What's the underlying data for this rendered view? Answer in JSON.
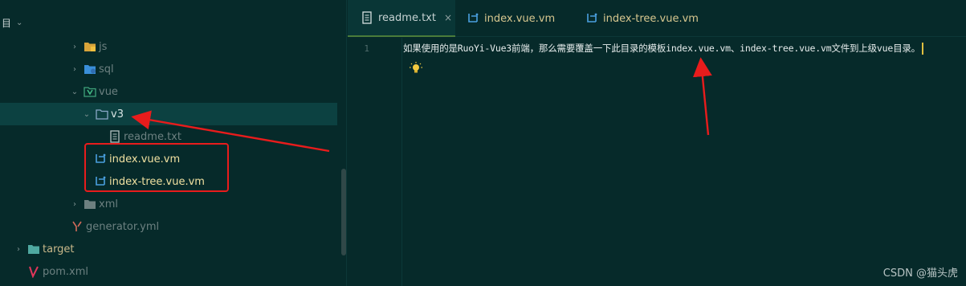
{
  "panel_header": {
    "title": "目",
    "chevron": "chevron-down-icon"
  },
  "tree": [
    {
      "label": "js",
      "icon": "folder-js-icon",
      "expanded": false
    },
    {
      "label": "sql",
      "icon": "folder-sql-icon",
      "expanded": false
    },
    {
      "label": "vue",
      "icon": "folder-vue-icon",
      "expanded": true
    },
    {
      "label": "v3",
      "icon": "folder-icon",
      "expanded": true,
      "selected": true
    },
    {
      "label": "readme.txt",
      "icon": "text-file-icon"
    },
    {
      "label": "index.vue.vm",
      "icon": "vm-template-icon"
    },
    {
      "label": "index-tree.vue.vm",
      "icon": "vm-template-icon"
    },
    {
      "label": "xml",
      "icon": "folder-icon",
      "expanded": false
    },
    {
      "label": "generator.yml",
      "icon": "yaml-file-icon"
    },
    {
      "label": "target",
      "icon": "folder-target-icon",
      "expanded": false
    },
    {
      "label": "pom.xml",
      "icon": "maven-icon"
    }
  ],
  "tabs": [
    {
      "label": "readme.txt",
      "icon": "text-file-icon",
      "active": true,
      "close": "×"
    },
    {
      "label": "index.vue.vm",
      "icon": "vm-template-icon",
      "active": false
    },
    {
      "label": "index-tree.vue.vm",
      "icon": "vm-template-icon",
      "active": false
    }
  ],
  "editor": {
    "line_number": "1",
    "content": "如果使用的是RuoYi-Vue3前端，那么需要覆盖一下此目录的模板index.vue.vm、index-tree.vue.vm文件到上级vue目录。"
  },
  "watermark": "CSDN @猫头虎",
  "colors": {
    "annotation": "#e81c1c",
    "background": "#062a2a",
    "selection": "#0c4141"
  }
}
